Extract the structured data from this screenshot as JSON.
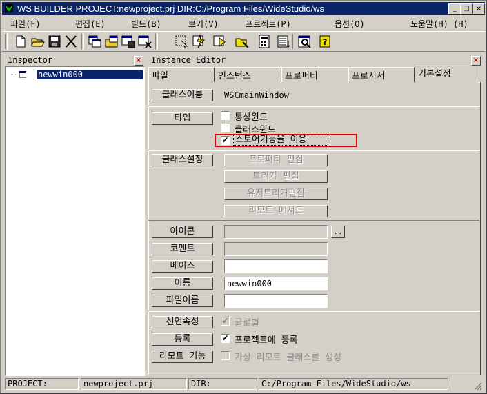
{
  "window": {
    "title": "WS BUILDER PROJECT:newproject.prj DIR:C:/Program Files/WideStudio/ws",
    "controls": [
      "_",
      "□",
      "×"
    ]
  },
  "menubar": [
    "파일(F)",
    "편집(E)",
    "빌드(B)",
    "보기(V)",
    "프로젝트(P)",
    "옵션(O)",
    "도움말(H) (H)"
  ],
  "toolbar_icons": [
    "new-file",
    "open-folder",
    "save",
    "cut",
    "copy-window",
    "open-window",
    "window-save",
    "window-close",
    "select",
    "build",
    "run",
    "open-dir",
    "calculator",
    "list",
    "inspect",
    "help"
  ],
  "inspector": {
    "title": "Inspector",
    "close": "×",
    "tree_item": "newwin000"
  },
  "instance_editor": {
    "title": "Instance Editor",
    "close": "×",
    "tabs": [
      "파일",
      "인스턴스",
      "프로퍼티",
      "프로시저",
      "기본설정"
    ]
  },
  "form": {
    "class_name_btn": "클래스이름",
    "class_name_value": "WSCmainWindow",
    "type_btn": "타입",
    "type_options": [
      {
        "label": "통상윈드",
        "checked": false
      },
      {
        "label": "클래스윈드",
        "checked": false
      },
      {
        "label": "스토어기능을 이용",
        "checked": true
      }
    ],
    "class_setting_btn": "클래스설정",
    "class_setting_buttons": [
      "프로퍼티 편집",
      "트리거 편집",
      "유저트리거편집",
      "리모트 메서드"
    ],
    "icon_btn": "아이콘",
    "icon_value": "",
    "ellipsis": "..",
    "comment_btn": "코멘트",
    "comment_value": "",
    "base_btn": "베이스",
    "base_value": "",
    "name_btn": "이름",
    "name_value": "newwin000",
    "filename_btn": "파일이름",
    "filename_value": "",
    "declare_btn": "선언속성",
    "global_label": "글로벌",
    "global_checked": true,
    "register_btn": "등록",
    "register_label": "프로젝트에 등록",
    "register_checked": true,
    "remote_btn": "리모트 기능",
    "remote_label": "가상 리모트 클래스를 생성",
    "remote_checked": false
  },
  "statusbar": {
    "project_label": "PROJECT:",
    "project_value": "newproject.prj",
    "dir_label": "DIR:",
    "dir_value": "C:/Program Files/WideStudio/ws"
  },
  "colors": {
    "titlebar": "#0a246a",
    "selection": "#0a246a",
    "highlight_border": "#e00000",
    "face": "#d4d0c8"
  }
}
